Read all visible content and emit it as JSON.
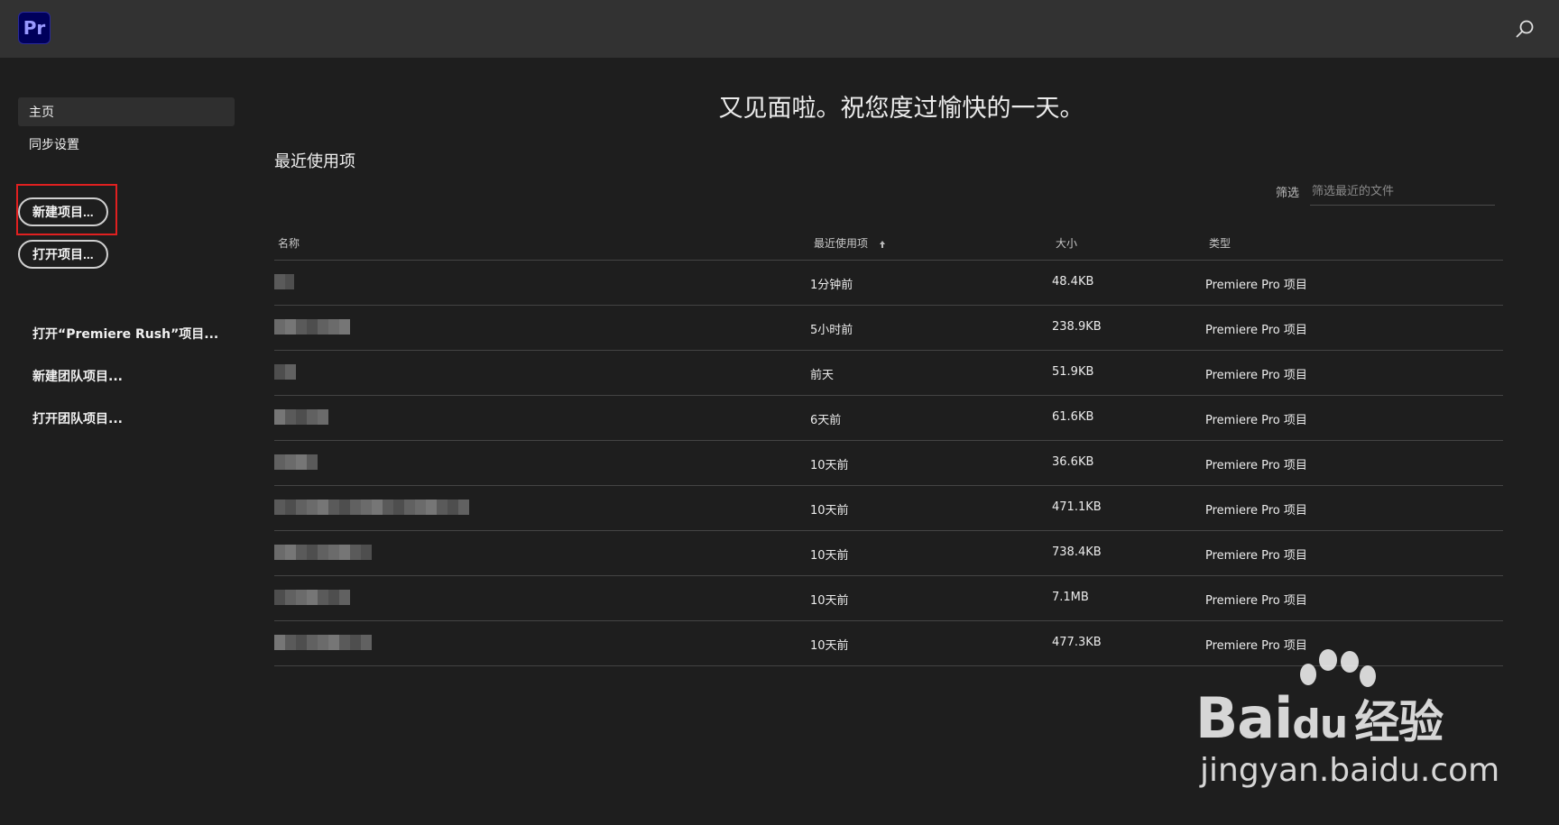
{
  "header": {
    "logo_text": "Pr",
    "search_icon": "search-icon"
  },
  "sidebar": {
    "nav": [
      {
        "label": "主页",
        "active": true
      },
      {
        "label": "同步设置",
        "active": false
      }
    ],
    "new_project": "新建项目...",
    "open_project": "打开项目...",
    "links": [
      {
        "label": "打开“Premiere Rush”项目..."
      },
      {
        "label": "新建团队项目..."
      },
      {
        "label": "打开团队项目..."
      }
    ]
  },
  "main": {
    "greeting": "又见面啦。祝您度过愉快的一天。",
    "recent_title": "最近使用项",
    "filter_label": "筛选",
    "filter_placeholder": "筛选最近的文件",
    "columns": {
      "name": "名称",
      "date": "最近使用项",
      "size": "大小",
      "type": "类型"
    },
    "rows": [
      {
        "date": "1分钟前",
        "size": "48.4KB",
        "type": "Premiere Pro 项目",
        "name_width": 22
      },
      {
        "date": "5小时前",
        "size": "238.9KB",
        "type": "Premiere Pro 项目",
        "name_width": 84
      },
      {
        "date": "前天",
        "size": "51.9KB",
        "type": "Premiere Pro 项目",
        "name_width": 24
      },
      {
        "date": "6天前",
        "size": "61.6KB",
        "type": "Premiere Pro 项目",
        "name_width": 60
      },
      {
        "date": "10天前",
        "size": "36.6KB",
        "type": "Premiere Pro 项目",
        "name_width": 48
      },
      {
        "date": "10天前",
        "size": "471.1KB",
        "type": "Premiere Pro 项目",
        "name_width": 216
      },
      {
        "date": "10天前",
        "size": "738.4KB",
        "type": "Premiere Pro 项目",
        "name_width": 108
      },
      {
        "date": "10天前",
        "size": "7.1MB",
        "type": "Premiere Pro 项目",
        "name_width": 84
      },
      {
        "date": "10天前",
        "size": "477.3KB",
        "type": "Premiere Pro 项目",
        "name_width": 108
      }
    ]
  },
  "watermark": {
    "brand": "Bai",
    "brand_du": "du",
    "brand_cn": "经验",
    "url": "jingyan.baidu.com"
  },
  "colors": {
    "background": "#1e1e1e",
    "header": "#323232",
    "logo_bg": "#00005b",
    "logo_text": "#9999ff",
    "highlight": "#e02020"
  }
}
